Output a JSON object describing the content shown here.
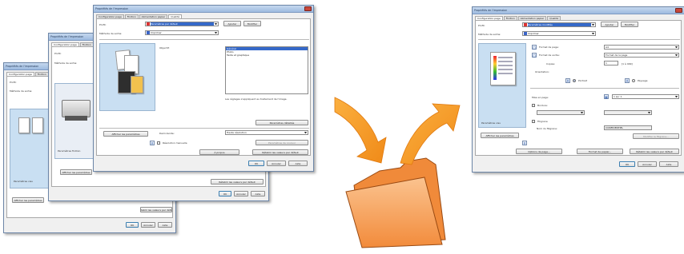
{
  "back_window": {
    "title": "Propriétés de l'impression",
    "tabs": [
      "Configuration page",
      "Finition"
    ],
    "labels": [
      "Profil:",
      "Méthode de sortie:"
    ],
    "preview_caption": "Paramètres visu",
    "buttons": {
      "show_settings": "Afficher les paramètres",
      "restore_defaults": "Rétablir les valeurs par défaut",
      "ok": "OK",
      "cancel": "Annuler",
      "help": "Aide"
    }
  },
  "middle_window": {
    "title": "Propriétés de l'impression",
    "tabs": [
      "Configuration page",
      "Finition"
    ],
    "labels": [
      "Profil:",
      "Méthode de sortie:"
    ],
    "preview_caption": "Paramètres finition",
    "buttons": {
      "show_settings": "Afficher les paramètres",
      "restore_defaults": "Rétablir les valeurs par défaut",
      "ok": "OK",
      "cancel": "Annuler",
      "help": "Aide"
    }
  },
  "front_window": {
    "title": "Propriétés de l'impression",
    "tabs": [
      "Configuration page",
      "Finition",
      "Alimentation papier",
      "Qualité"
    ],
    "labels": {
      "profile": "Profil:",
      "output": "Méthode de sortie:",
      "objective": "Objectif:",
      "halftone": "Demi-teinte:"
    },
    "profile_value": "Paramètres par défaut",
    "output_value": "Imprimer",
    "objective_items": [
      "Général",
      "Photo",
      "Texte et graphique"
    ],
    "objective_desc": "Les réglages s'appliquent au traitement de l'image.",
    "halftone_value": "Haute résolution",
    "checkbox_label": "Résolution manuelle",
    "buttons": {
      "show_settings": "Afficher les paramètres",
      "details": "Paramètres détaillés",
      "color_settings": "Paramètres de couleur",
      "restore_defaults": "Rétablir les valeurs par défaut",
      "about": "À propos",
      "ok": "OK",
      "cancel": "Annuler",
      "help": "Aide",
      "add": "Ajouter",
      "edit": "Modifier"
    }
  },
  "right_window": {
    "title": "Propriétés de l'impression",
    "tabs": [
      "Configuration page",
      "Finition",
      "Alimentation papier",
      "Qualité"
    ],
    "labels": {
      "profile": "Profil:",
      "output": "Méthode de sortie:",
      "page_size": "Format de page:",
      "output_size": "Format de sortie:",
      "copies": "Copies:",
      "orientation": "Orientation:",
      "page_layout": "Mise en page:",
      "border": "Bordure:",
      "watermark": "Filigrane",
      "watermark_name": "Nom du filigrane:"
    },
    "profile_value": "Paramètres modifiés",
    "output_value": "Imprimer",
    "page_size_value": "A4",
    "output_size_value": "Format de la page",
    "copies_value": "1",
    "copies_range": "[1 à 999]",
    "orientation_options": [
      "Portrait",
      "Paysage"
    ],
    "layout_value": "1 sur 1",
    "watermark_name_value": "CONFIDENTIEL",
    "preview_caption": "Paramètres visu",
    "buttons": {
      "add": "Ajouter",
      "edit": "Modifier",
      "show_settings": "Afficher les paramètres",
      "watermark_edit": "Modifier le filigrane...",
      "page_options": "Options de page...",
      "paper_size_options": "Format de papier...",
      "restore_defaults": "Rétablir les valeurs par défaut",
      "ok": "OK",
      "cancel": "Annuler",
      "help": "Aide"
    }
  },
  "colors": {
    "arrow": "#f28a17",
    "arrow_light": "#fbb040",
    "folder_front": "#f7a35a",
    "folder_back": "#f0883a",
    "folder_stroke": "#9a4a12",
    "window_border": "#6d86a8"
  },
  "icons": [
    "orange-arrow-in-icon",
    "folder-icon",
    "orange-arrow-out-icon",
    "printer-icon",
    "page-preview-icon"
  ]
}
